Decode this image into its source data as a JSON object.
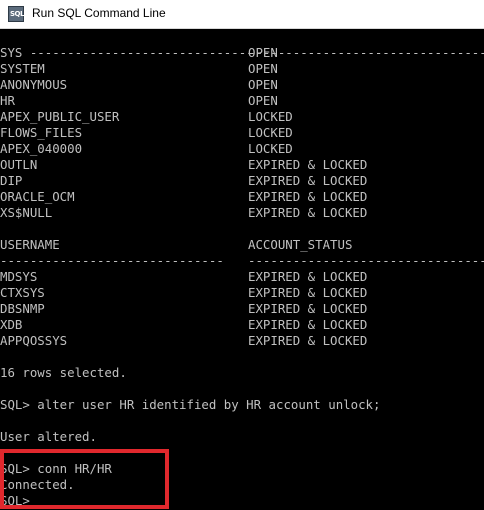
{
  "window": {
    "title": "Run SQL Command Line",
    "icon_label": "SQL"
  },
  "console": {
    "separator_top": {
      "a": "------------------------------",
      "b": "--------------------------------"
    },
    "rows_1": [
      {
        "username": "SYS",
        "status": "OPEN"
      },
      {
        "username": "SYSTEM",
        "status": "OPEN"
      },
      {
        "username": "ANONYMOUS",
        "status": "OPEN"
      },
      {
        "username": "HR",
        "status": "OPEN"
      },
      {
        "username": "APEX_PUBLIC_USER",
        "status": "LOCKED"
      },
      {
        "username": "FLOWS_FILES",
        "status": "LOCKED"
      },
      {
        "username": "APEX_040000",
        "status": "LOCKED"
      },
      {
        "username": "OUTLN",
        "status": "EXPIRED & LOCKED"
      },
      {
        "username": "DIP",
        "status": "EXPIRED & LOCKED"
      },
      {
        "username": "ORACLE_OCM",
        "status": "EXPIRED & LOCKED"
      },
      {
        "username": "XS$NULL",
        "status": "EXPIRED & LOCKED"
      }
    ],
    "header": {
      "username": "USERNAME",
      "status": "ACCOUNT_STATUS"
    },
    "separator_mid": {
      "a": "------------------------------",
      "b": "--------------------------------"
    },
    "rows_2": [
      {
        "username": "MDSYS",
        "status": "EXPIRED & LOCKED"
      },
      {
        "username": "CTXSYS",
        "status": "EXPIRED & LOCKED"
      },
      {
        "username": "DBSNMP",
        "status": "EXPIRED & LOCKED"
      },
      {
        "username": "XDB",
        "status": "EXPIRED & LOCKED"
      },
      {
        "username": "APPQOSSYS",
        "status": "EXPIRED & LOCKED"
      }
    ],
    "rows_selected": "16 rows selected.",
    "alter_command": "SQL> alter user HR identified by HR account unlock;",
    "user_altered": "User altered.",
    "conn_command": "SQL> conn HR/HR",
    "connected": "Connected.",
    "prompt": "SQL>"
  },
  "colors": {
    "highlight_border": "#e0282d",
    "console_bg": "#000000",
    "console_text": "#c0c0c0"
  }
}
